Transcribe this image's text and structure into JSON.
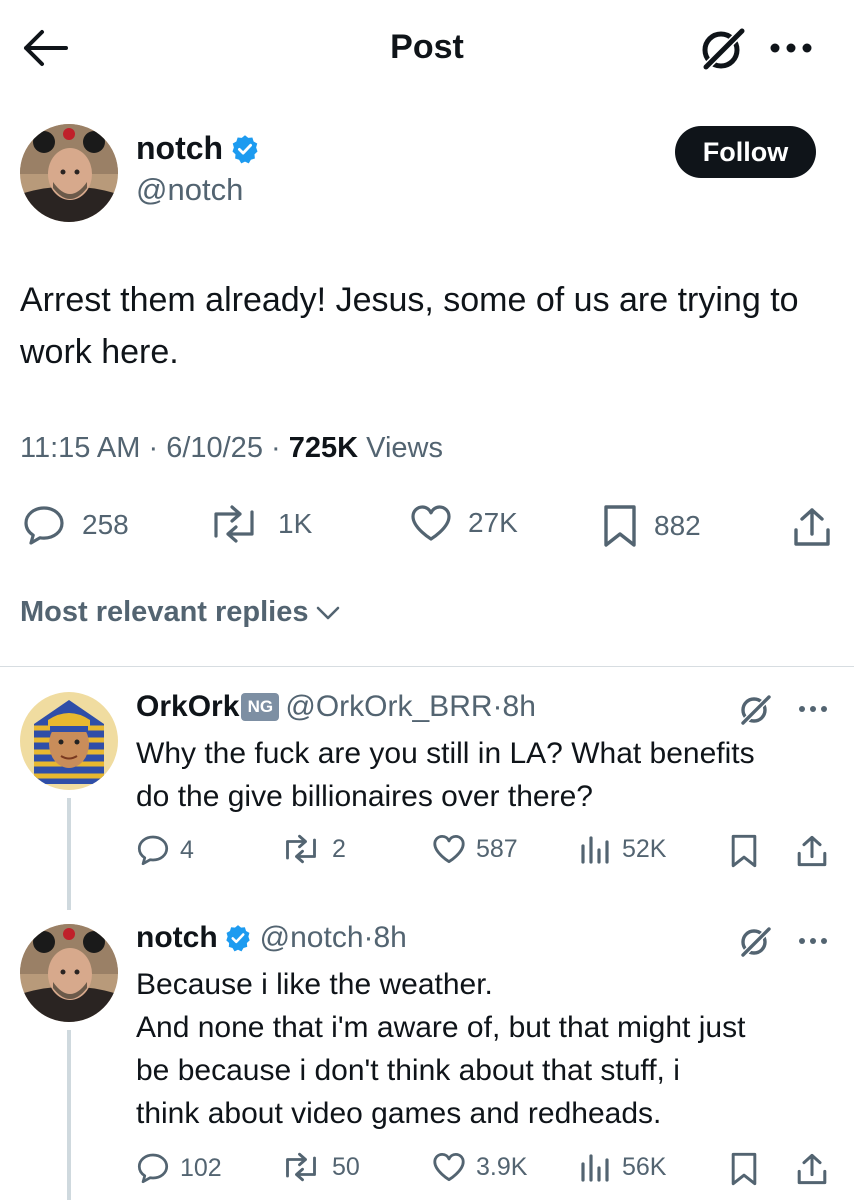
{
  "header": {
    "title": "Post"
  },
  "post": {
    "author": {
      "name": "notch",
      "handle": "@notch",
      "verified": true
    },
    "follow_label": "Follow",
    "text": "Arrest them already! Jesus, some of us are trying to work here.",
    "time": "11:15 AM",
    "date": "6/10/25",
    "separator": "·",
    "views_count": "725K",
    "views_label": "Views",
    "stats": {
      "replies": "258",
      "reposts": "1K",
      "likes": "27K",
      "bookmarks": "882"
    }
  },
  "replies_filter": {
    "label": "Most relevant replies"
  },
  "replies": [
    {
      "name": "OrkOrk",
      "badge": "NG",
      "handle": "@OrkOrk_BRR",
      "time": "·8h",
      "text_lines": [
        "Why the fuck are you still in LA? What benefits",
        "do the give billionaires over there?"
      ],
      "stats": {
        "replies": "4",
        "reposts": "2",
        "likes": "587",
        "views": "52K"
      }
    },
    {
      "name": "notch",
      "verified": true,
      "handle": "@notch",
      "time": "·8h",
      "text_lines": [
        "Because i like the weather.",
        "And none that i'm aware of, but that might just",
        "be because i don't think about that stuff, i",
        "think about video games and redheads."
      ],
      "stats": {
        "replies": "102",
        "reposts": "50",
        "likes": "3.9K",
        "views": "56K"
      }
    }
  ],
  "colors": {
    "text": "#0f1419",
    "secondary": "#536471",
    "verified_blue": "#1d9bf0",
    "divider": "#d7dde1",
    "follow_bg": "#0f1419"
  }
}
